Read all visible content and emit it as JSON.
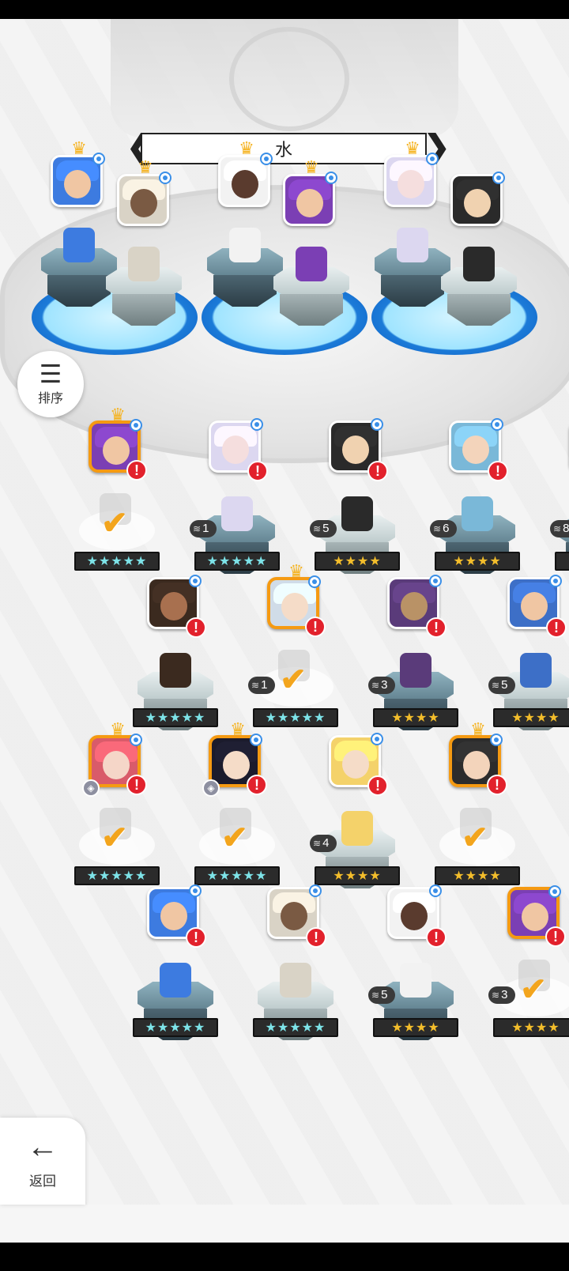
{
  "header": {
    "title": "水"
  },
  "controls": {
    "sort_label": "排序",
    "back_label": "返回"
  },
  "colors": {
    "selected_border": "#f59a12",
    "alert": "#e2212c",
    "badge_dot": "#3a8fe8",
    "star_gold": "#f3bd2b",
    "star_rainbow": "#7de3e8"
  },
  "team": [
    {
      "crown": true
    },
    {
      "crown": true
    },
    {
      "crown": true
    },
    {
      "crown": true
    },
    {
      "crown": true
    },
    {
      "crown": false
    }
  ],
  "roster": [
    {
      "stars": "★★★★★",
      "star_style": "rainbow",
      "count": "",
      "selected": true,
      "crown": true,
      "owned_check": true,
      "alert": "!"
    },
    {
      "stars": "★★★★★",
      "star_style": "rainbow",
      "count": "1",
      "selected": false,
      "crown": false,
      "owned_check": false,
      "alert": "!"
    },
    {
      "stars": "★★★★",
      "star_style": "gold",
      "count": "5",
      "selected": false,
      "crown": false,
      "owned_check": false,
      "alert": "!"
    },
    {
      "stars": "★★★★",
      "star_style": "gold",
      "count": "6",
      "selected": false,
      "crown": false,
      "owned_check": false,
      "alert": "!"
    },
    {
      "stars": "",
      "star_style": "gold",
      "count": "8",
      "selected": false,
      "crown": false,
      "owned_check": false,
      "alert": ""
    },
    {
      "stars": "★★★★★",
      "star_style": "rainbow",
      "count": "",
      "selected": false,
      "crown": false,
      "owned_check": false,
      "alert": "!"
    },
    {
      "stars": "★★★★★",
      "star_style": "rainbow",
      "count": "1",
      "selected": true,
      "crown": true,
      "owned_check": true,
      "alert": "!"
    },
    {
      "stars": "★★★★",
      "star_style": "gold",
      "count": "3",
      "selected": false,
      "crown": false,
      "owned_check": false,
      "alert": "!"
    },
    {
      "stars": "★★★★",
      "star_style": "gold",
      "count": "5",
      "selected": false,
      "crown": false,
      "owned_check": false,
      "alert": "!"
    },
    {
      "stars": "★★★★★",
      "star_style": "rainbow",
      "count": "",
      "selected": true,
      "crown": true,
      "owned_check": true,
      "alert": "!"
    },
    {
      "stars": "★★★★★",
      "star_style": "rainbow",
      "count": "",
      "selected": true,
      "crown": true,
      "owned_check": true,
      "alert": "!"
    },
    {
      "stars": "★★★★",
      "star_style": "gold",
      "count": "4",
      "selected": false,
      "crown": false,
      "owned_check": false,
      "alert": "!"
    },
    {
      "stars": "★★★★",
      "star_style": "gold",
      "count": "",
      "selected": true,
      "crown": true,
      "owned_check": true,
      "alert": "!"
    },
    {
      "stars": "★★★★★",
      "star_style": "rainbow",
      "count": "",
      "selected": false,
      "crown": false,
      "owned_check": false,
      "alert": "!"
    },
    {
      "stars": "★★★★★",
      "star_style": "rainbow",
      "count": "",
      "selected": false,
      "crown": false,
      "owned_check": false,
      "alert": "!"
    },
    {
      "stars": "★★★★",
      "star_style": "gold",
      "count": "5",
      "selected": false,
      "crown": false,
      "owned_check": false,
      "alert": "!"
    },
    {
      "stars": "★★★★",
      "star_style": "gold",
      "count": "3",
      "selected": true,
      "crown": false,
      "owned_check": true,
      "alert": "!"
    }
  ]
}
